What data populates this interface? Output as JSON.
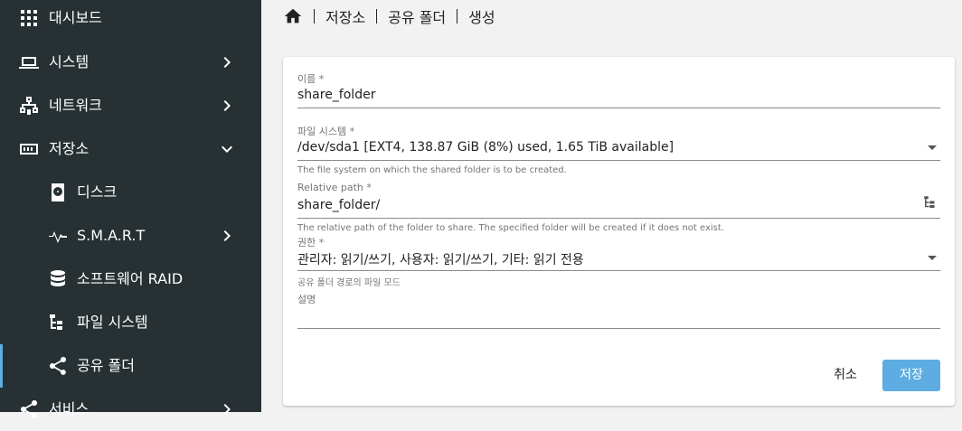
{
  "sidebar": {
    "items": [
      {
        "label": "대시보드",
        "icon": "dashboard-grid-icon"
      },
      {
        "label": "시스템",
        "icon": "laptop-icon"
      },
      {
        "label": "네트워크",
        "icon": "network-icon"
      },
      {
        "label": "저장소",
        "icon": "storage-icon"
      },
      {
        "label": "디스크",
        "icon": "harddisk-icon"
      },
      {
        "label": "S.M.A.R.T",
        "icon": "pulse-icon"
      },
      {
        "label": "소프트웨어 RAID",
        "icon": "database-icon"
      },
      {
        "label": "파일 시스템",
        "icon": "file-tree-icon"
      },
      {
        "label": "공유 폴더",
        "icon": "share-icon"
      },
      {
        "label": "서비스",
        "icon": "share-icon"
      }
    ],
    "active_item": "공유 폴더",
    "accent": "#5dade2",
    "background": "#273033"
  },
  "breadcrumb": {
    "items": [
      "저장소",
      "공유 폴더",
      "생성"
    ]
  },
  "form": {
    "name": {
      "label": "이름 *",
      "value": "share_folder"
    },
    "filesystem": {
      "label": "파일 시스템 *",
      "value": "/dev/sda1 [EXT4, 138.87 GiB (8%) used, 1.65 TiB available]",
      "hint": "The file system on which the shared folder is to be created."
    },
    "relpath": {
      "label": "Relative path *",
      "value": "share_folder/",
      "hint": "The relative path of the folder to share. The specified folder will be created if it does not exist."
    },
    "permissions": {
      "label": "권한 *",
      "value": "관리자: 읽기/쓰기, 사용자: 읽기/쓰기, 기타: 읽기 전용",
      "hint": "공유 폴더 경로의 파일 모드"
    },
    "comment": {
      "label": "설명",
      "value": ""
    }
  },
  "actions": {
    "cancel": "취소",
    "save": "저장",
    "save_color": "#5dade2"
  }
}
